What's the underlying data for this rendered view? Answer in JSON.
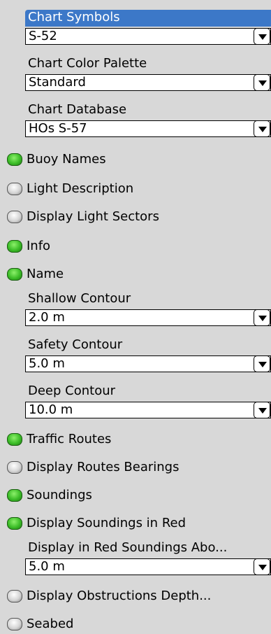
{
  "settings": {
    "chart_symbols": {
      "label": "Chart Symbols",
      "value": "S-52"
    },
    "chart_color_palette": {
      "label": "Chart Color Palette",
      "value": "Standard"
    },
    "chart_database": {
      "label": "Chart Database",
      "value": "HOs S-57"
    },
    "buoy_names": {
      "label": "Buoy Names",
      "on": true
    },
    "light_description": {
      "label": "Light Description",
      "on": false
    },
    "display_light_sectors": {
      "label": "Display Light Sectors",
      "on": false
    },
    "info": {
      "label": "Info",
      "on": true
    },
    "name": {
      "label": "Name",
      "on": true
    },
    "shallow_contour": {
      "label": "Shallow Contour",
      "value": "2.0 m"
    },
    "safety_contour": {
      "label": "Safety Contour",
      "value": "5.0 m"
    },
    "deep_contour": {
      "label": "Deep Contour",
      "value": "10.0 m"
    },
    "traffic_routes": {
      "label": "Traffic Routes",
      "on": true
    },
    "display_routes_bearings": {
      "label": "Display Routes Bearings",
      "on": false
    },
    "soundings": {
      "label": "Soundings",
      "on": true
    },
    "display_soundings_in_red": {
      "label": "Display Soundings in Red",
      "on": true
    },
    "red_soundings_above": {
      "label": "Display in Red Soundings Abo...",
      "value": "5.0 m"
    },
    "display_obstructions_depth": {
      "label": "Display Obstructions Depth...",
      "on": false
    },
    "seabed": {
      "label": "Seabed",
      "on": false
    }
  },
  "colors": {
    "highlight": "#3c78c8",
    "led_on": "#3cbd28",
    "led_off": "#d6d6d6",
    "panel_bg": "#d8d8d8"
  }
}
